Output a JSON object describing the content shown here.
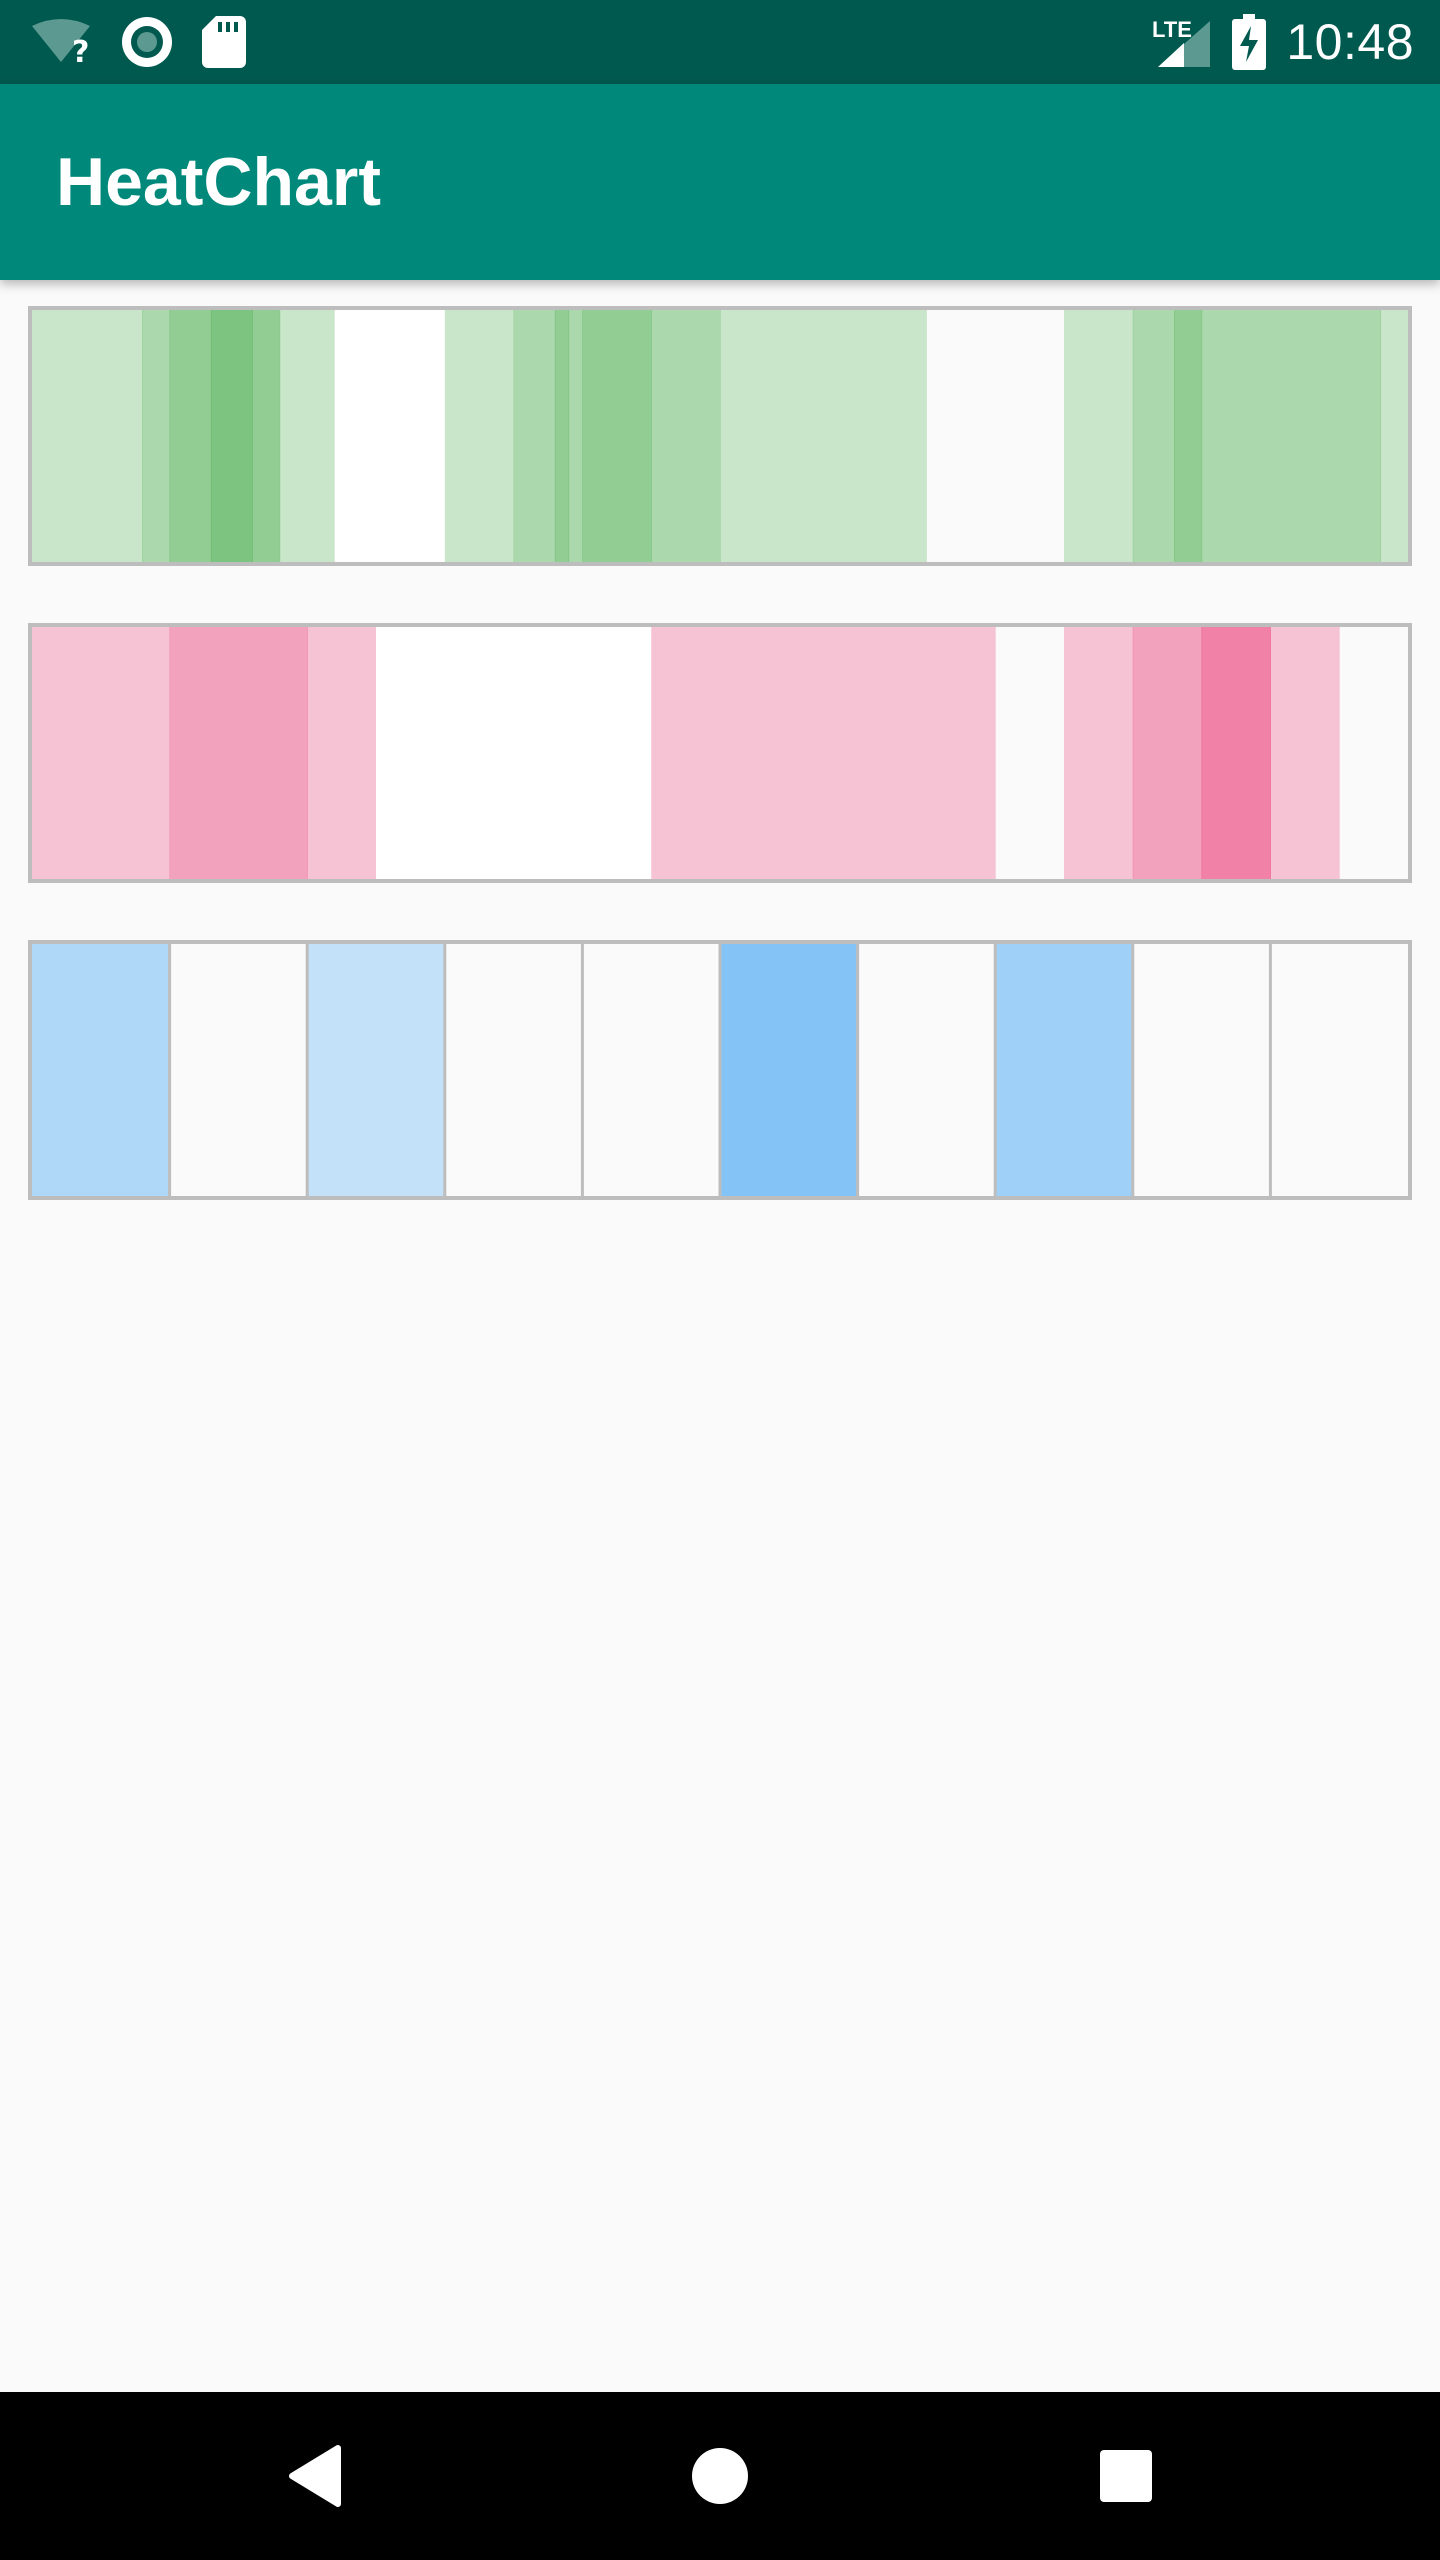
{
  "status_bar": {
    "time": "10:48",
    "network_label": "LTE",
    "icons": [
      "wifi-unknown-icon",
      "sync-icon",
      "sd-card-icon",
      "lte-signal-icon",
      "battery-charging-icon"
    ]
  },
  "app_bar": {
    "title": "HeatChart"
  },
  "charts": [
    {
      "name": "green",
      "base_color": "#4caf50",
      "segments": [
        {
          "from": 0,
          "to": 0.8,
          "opacity": 0.28
        },
        {
          "from": 0.8,
          "to": 1.0,
          "opacity": 0.45
        },
        {
          "from": 1.0,
          "to": 1.3,
          "opacity": 0.6
        },
        {
          "from": 1.3,
          "to": 1.6,
          "opacity": 0.72
        },
        {
          "from": 1.6,
          "to": 1.8,
          "opacity": 0.6
        },
        {
          "from": 1.8,
          "to": 2.2,
          "opacity": 0.28
        },
        {
          "from": 2.2,
          "to": 3.0,
          "opacity": 0.0,
          "fill": "#ffffff"
        },
        {
          "from": 3.0,
          "to": 3.5,
          "opacity": 0.28
        },
        {
          "from": 3.5,
          "to": 3.8,
          "opacity": 0.45
        },
        {
          "from": 3.8,
          "to": 3.9,
          "opacity": 0.6
        },
        {
          "from": 3.9,
          "to": 4.0,
          "opacity": 0.45
        },
        {
          "from": 4.0,
          "to": 4.5,
          "opacity": 0.6
        },
        {
          "from": 4.5,
          "to": 5.0,
          "opacity": 0.45
        },
        {
          "from": 5.0,
          "to": 6.5,
          "opacity": 0.28
        },
        {
          "from": 6.5,
          "to": 7.5,
          "opacity": 0.0
        },
        {
          "from": 7.5,
          "to": 8.0,
          "opacity": 0.28
        },
        {
          "from": 8.0,
          "to": 8.3,
          "opacity": 0.45
        },
        {
          "from": 8.3,
          "to": 8.5,
          "opacity": 0.6
        },
        {
          "from": 8.5,
          "to": 9.8,
          "opacity": 0.45
        },
        {
          "from": 9.8,
          "to": 10.0,
          "opacity": 0.28
        }
      ]
    },
    {
      "name": "pink",
      "base_color": "#e91e63",
      "segments": [
        {
          "from": 0,
          "to": 1.0,
          "opacity": 0.25
        },
        {
          "from": 1.0,
          "to": 2.0,
          "opacity": 0.4
        },
        {
          "from": 2.0,
          "to": 2.5,
          "opacity": 0.25
        },
        {
          "from": 2.5,
          "to": 4.5,
          "opacity": 0.0,
          "fill": "#ffffff"
        },
        {
          "from": 4.5,
          "to": 7.0,
          "opacity": 0.25
        },
        {
          "from": 7.0,
          "to": 7.5,
          "opacity": 0.0
        },
        {
          "from": 7.5,
          "to": 8.0,
          "opacity": 0.25
        },
        {
          "from": 8.0,
          "to": 8.5,
          "opacity": 0.4
        },
        {
          "from": 8.5,
          "to": 9.0,
          "opacity": 0.55
        },
        {
          "from": 9.0,
          "to": 9.5,
          "opacity": 0.25
        },
        {
          "from": 9.5,
          "to": 10.0,
          "opacity": 0.0
        }
      ]
    },
    {
      "name": "blue",
      "base_color": "#2196f3",
      "grid": true,
      "cells": [
        0.35,
        0.0,
        0.25,
        0.0,
        0.0,
        0.55,
        0.0,
        0.42,
        0.0,
        0.0
      ]
    }
  ],
  "nav_bar": {
    "buttons": [
      "back",
      "home",
      "recents"
    ]
  }
}
